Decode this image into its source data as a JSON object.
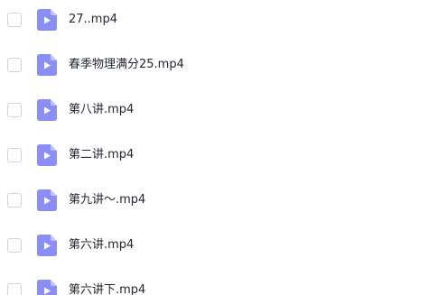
{
  "file_list": {
    "items": [
      {
        "name": "27..mp4",
        "type": "video",
        "icon": "video-file-icon",
        "checked": false
      },
      {
        "name": "春季物理满分25.mp4",
        "type": "video",
        "icon": "video-file-icon",
        "checked": false
      },
      {
        "name": "第八讲.mp4",
        "type": "video",
        "icon": "video-file-icon",
        "checked": false
      },
      {
        "name": "第二讲.mp4",
        "type": "video",
        "icon": "video-file-icon",
        "checked": false
      },
      {
        "name": "第九讲～.mp4",
        "type": "video",
        "icon": "video-file-icon",
        "checked": false
      },
      {
        "name": "第六讲.mp4",
        "type": "video",
        "icon": "video-file-icon",
        "checked": false
      },
      {
        "name": "第六讲下.mp4",
        "type": "video",
        "icon": "video-file-icon",
        "checked": false
      }
    ]
  },
  "colors": {
    "icon_fill": "#8b8ff5",
    "icon_fold": "#c1c3fb",
    "checkbox_border": "#cfd3da",
    "text": "#222731"
  }
}
